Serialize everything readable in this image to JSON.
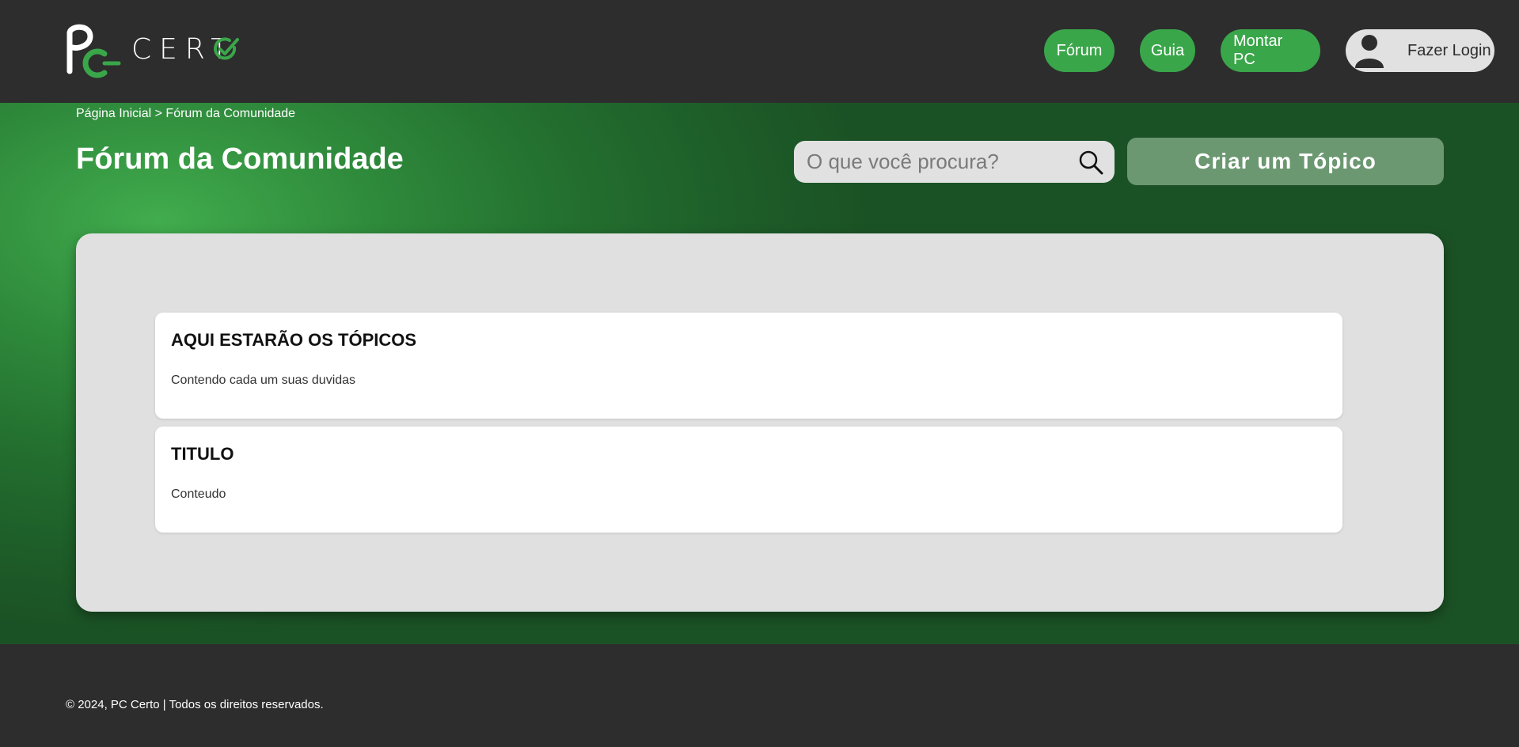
{
  "brand": {
    "logo_text": "CERT",
    "accent_color": "#3aa64a"
  },
  "nav": {
    "items": [
      {
        "label": "Fórum"
      },
      {
        "label": "Guia"
      },
      {
        "label": "Montar PC"
      }
    ],
    "login_label": "Fazer Login"
  },
  "breadcrumb": {
    "home": "Página Inicial",
    "separator": ">",
    "current": "Fórum da Comunidade"
  },
  "page": {
    "title": "Fórum da Comunidade"
  },
  "search": {
    "placeholder": "O que você procura?",
    "value": ""
  },
  "actions": {
    "create_topic_label": "Criar um Tópico"
  },
  "topics": [
    {
      "title": "AQUI ESTARÃO OS TÓPICOS",
      "content": "Contendo cada um suas duvidas"
    },
    {
      "title": "TITULO",
      "content": "Conteudo"
    }
  ],
  "footer": {
    "copyright": "© 2024, PC Certo | Todos os direitos reservados."
  }
}
